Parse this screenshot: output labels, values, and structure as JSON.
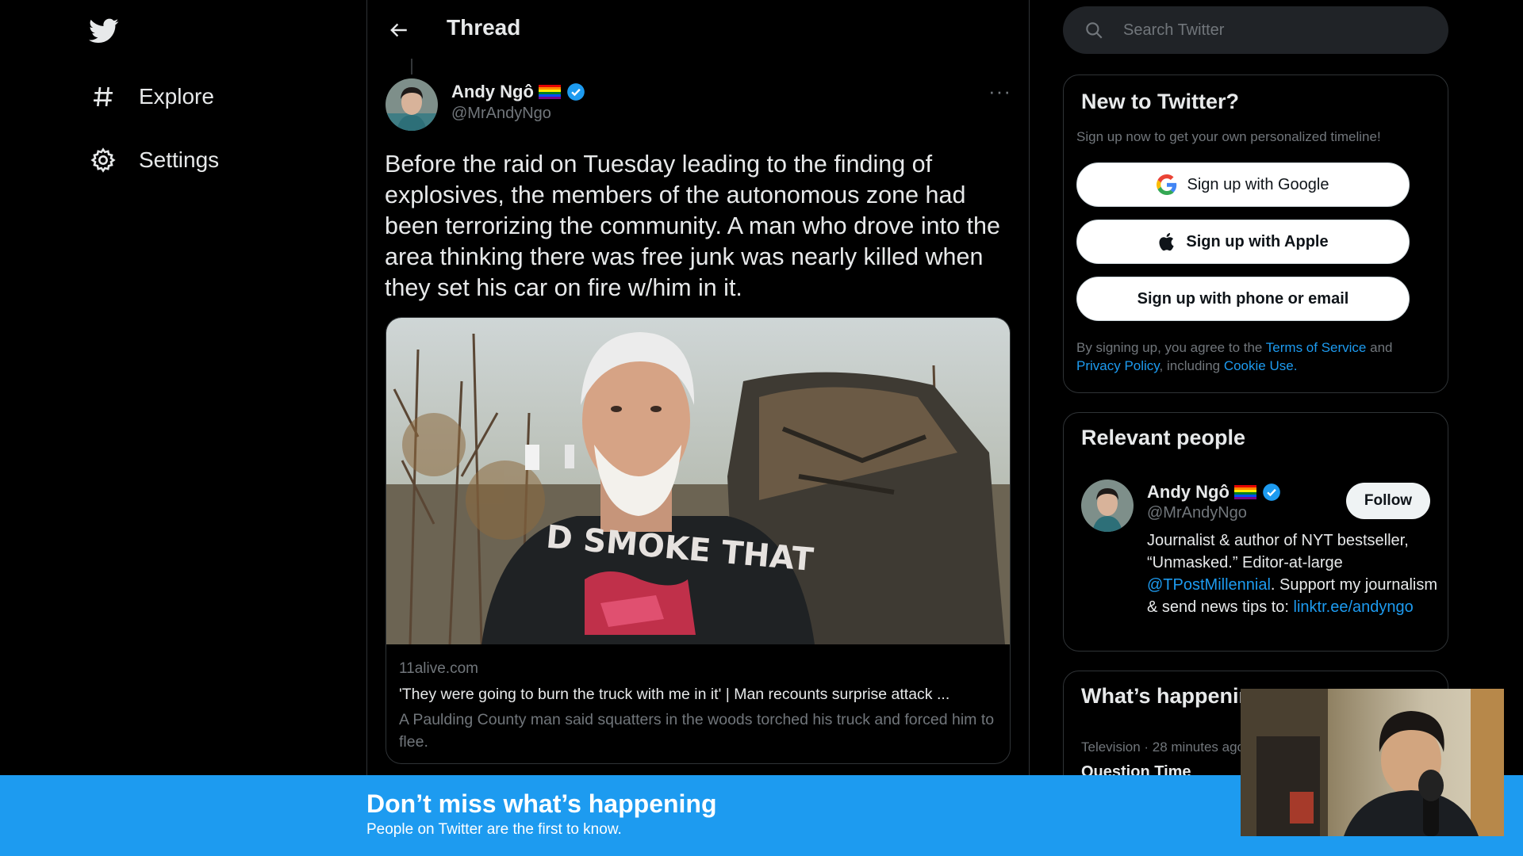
{
  "nav": {
    "items": [
      {
        "label": "Explore",
        "icon": "hashtag-icon"
      },
      {
        "label": "Settings",
        "icon": "gear-icon"
      }
    ]
  },
  "header": {
    "title": "Thread"
  },
  "tweet": {
    "author_name": "Andy Ngô",
    "author_handle": "@MrAndyNgo",
    "text": "Before the raid on Tuesday leading to the finding of explosives, the members of the autonomous zone had been terrorizing the community. A man who drove into the area thinking there was free junk was nearly killed when they set his car on fire w/him in it.",
    "card": {
      "domain": "11alive.com",
      "title": "'They were going to burn the truck with me in it' | Man recounts surprise attack ...",
      "description": "A Paulding County man said squatters in the woods torched his truck and forced him to flee.",
      "image_shirt_text": "D SMOKE THAT"
    }
  },
  "search": {
    "placeholder": "Search Twitter"
  },
  "new_to_twitter": {
    "title": "New to Twitter?",
    "subtitle": "Sign up now to get your own personalized timeline!",
    "google_label": "Sign up with Google",
    "apple_label": "Sign up with Apple",
    "phone_label": "Sign up with phone or email",
    "terms_pre": "By signing up, you agree to the ",
    "terms_link": "Terms of Service",
    "terms_and": " and ",
    "privacy_link": "Privacy Policy",
    "terms_including": ", including ",
    "cookie_link": "Cookie Use",
    "terms_end": "."
  },
  "relevant_people": {
    "title": "Relevant people",
    "name": "Andy Ngô",
    "handle": "@MrAndyNgo",
    "follow_label": "Follow",
    "bio_1": "Journalist & author of NYT bestseller, “Unmasked.” Editor-at-large ",
    "bio_link_1": "@TPostMillennial",
    "bio_2": ". Support my journalism & send news tips to: ",
    "bio_link_2": "linktr.ee/andyngo"
  },
  "whats_happening": {
    "title": "What’s happening",
    "meta": "Television · 28 minutes ago",
    "topic": "Question Time"
  },
  "banner": {
    "title": "Don’t miss what’s happening",
    "subtitle": "People on Twitter are the first to know."
  },
  "colors": {
    "accent": "#1d9bf0",
    "background": "#000000",
    "text_primary": "#e7e9ea",
    "text_secondary": "#71767b"
  }
}
